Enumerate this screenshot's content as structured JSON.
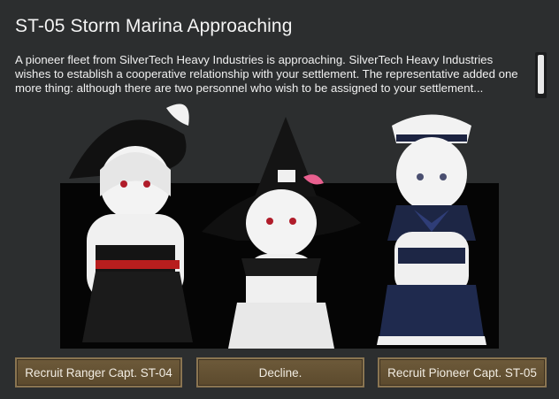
{
  "dialog": {
    "title": "ST-05 Storm Marina Approaching",
    "body": "A pioneer fleet from SilverTech Heavy Industries is approaching. SilverTech Heavy Industries wishes to establish a cooperative relationship with your settlement. The representative added one more thing: although there are two personnel who wish to be assigned to your settlement..."
  },
  "buttons": {
    "recruit_ranger": "Recruit Ranger Capt. ST-04",
    "decline": "Decline.",
    "recruit_pioneer": "Recruit Pioneer Capt. ST-05"
  },
  "colors": {
    "background": "#2c2e2f",
    "button_fill": "#5f4c2f",
    "button_border": "#8a7551"
  }
}
